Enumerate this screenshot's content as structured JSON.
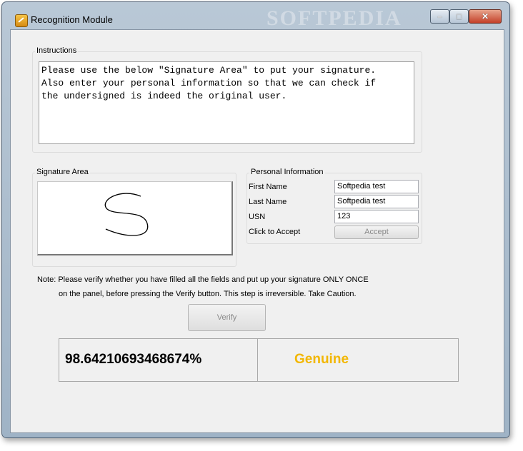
{
  "window": {
    "title": "Recognition Module",
    "watermark": "SOFTPEDIA"
  },
  "instructions": {
    "label": "Instructions",
    "text": "Please use the below \"Signature Area\" to put your signature.\nAlso enter your personal information so that we can check if\nthe undersigned is indeed the original user."
  },
  "signature": {
    "label": "Signature Area"
  },
  "personal": {
    "label": "Personal Information",
    "first_name_label": "First Name",
    "first_name_value": "Softpedia test",
    "last_name_label": "Last Name",
    "last_name_value": "Softpedia test",
    "usn_label": "USN",
    "usn_value": "123",
    "accept_label": "Click to Accept",
    "accept_button": "Accept"
  },
  "note": {
    "line1": "Note: Please verify whether you have filled all the fields and put up your signature ONLY ONCE",
    "line2": "on the panel, before pressing the Verify button. This step is irreversible. Take Caution."
  },
  "verify_button": "Verify",
  "result": {
    "score": "98.64210693468674%",
    "verdict": "Genuine",
    "verdict_color": "#f2b705"
  }
}
